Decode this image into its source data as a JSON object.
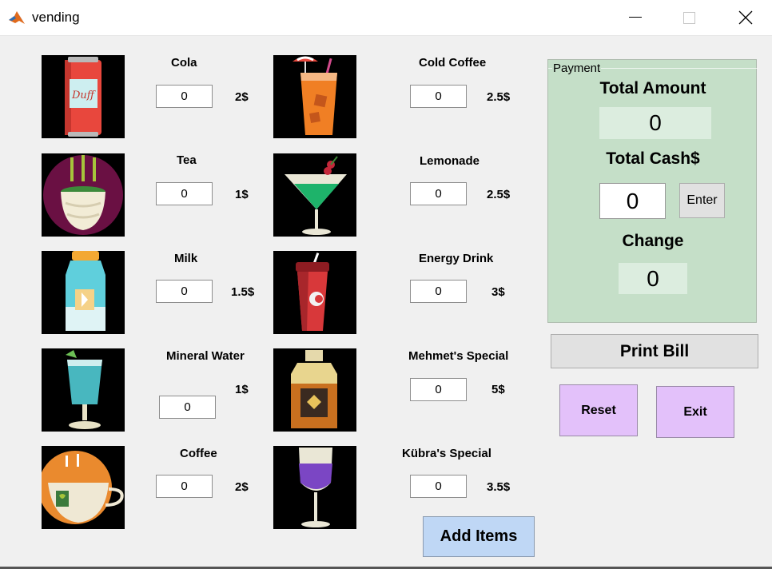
{
  "window": {
    "title": "vending"
  },
  "colors": {
    "payment_panel": "#c5dfc8",
    "value_box": "#dceddf",
    "purple_button": "#e3c1fa",
    "blue_button": "#bfd7f5"
  },
  "items": [
    {
      "name": "Cola",
      "qty": "0",
      "price": "2$",
      "image": "cola-can-icon"
    },
    {
      "name": "Tea",
      "qty": "0",
      "price": "1$",
      "image": "tea-cup-icon"
    },
    {
      "name": "Milk",
      "qty": "0",
      "price": "1.5$",
      "image": "milk-bottle-icon"
    },
    {
      "name": "Mineral Water",
      "qty": "0",
      "price": "1$",
      "image": "water-glass-icon"
    },
    {
      "name": "Coffee",
      "qty": "0",
      "price": "2$",
      "image": "coffee-cup-icon"
    },
    {
      "name": "Cold Coffee",
      "qty": "0",
      "price": "2.5$",
      "image": "iced-coffee-icon"
    },
    {
      "name": "Lemonade",
      "qty": "0",
      "price": "2.5$",
      "image": "cocktail-icon"
    },
    {
      "name": "Energy Drink",
      "qty": "0",
      "price": "3$",
      "image": "energy-cup-icon"
    },
    {
      "name": "Mehmet's Special",
      "qty": "0",
      "price": "5$",
      "image": "whiskey-bottle-icon"
    },
    {
      "name": "Kübra's Special",
      "qty": "0",
      "price": "3.5$",
      "image": "wine-glass-icon"
    }
  ],
  "payment": {
    "legend": "Payment",
    "total_amount_label": "Total Amount",
    "total_amount_value": "0",
    "total_cash_label": "Total Cash$",
    "total_cash_value": "0",
    "enter_label": "Enter",
    "change_label": "Change",
    "change_value": "0"
  },
  "buttons": {
    "print_bill": "Print Bill",
    "reset": "Reset",
    "exit": "Exit",
    "add_items": "Add Items"
  }
}
